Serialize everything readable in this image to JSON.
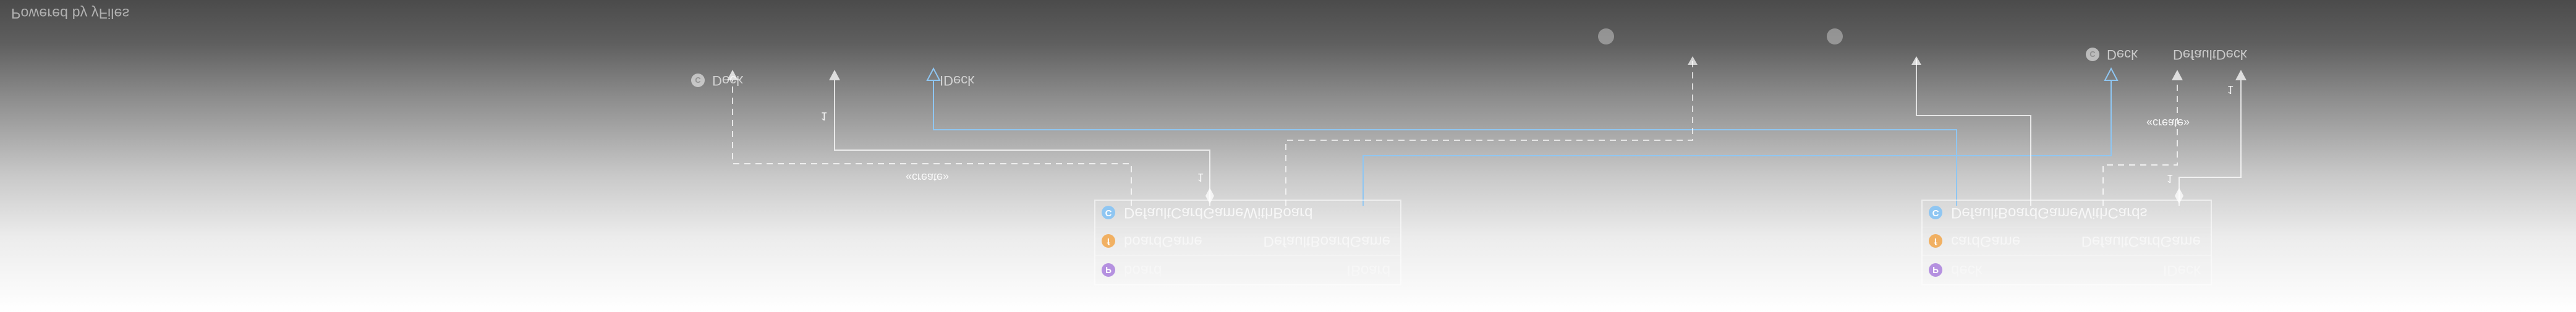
{
  "watermark": "Powered by yFiles",
  "classes": {
    "left": {
      "name": "DefaultCardGameWithBoard",
      "kind_badge": "C",
      "fields": [
        {
          "badge": "f",
          "name": "boardGame",
          "type": "DefaultBoardGame"
        },
        {
          "badge": "p",
          "name": "board",
          "type": "IBoard"
        }
      ]
    },
    "right": {
      "name": "DefaultBoardGameWithCards",
      "kind_badge": "C",
      "fields": [
        {
          "badge": "f",
          "name": "cardGame",
          "type": "DefaultCardGame"
        },
        {
          "badge": "p",
          "name": "deck",
          "type": "IDeck"
        }
      ]
    }
  },
  "relations": {
    "create_left": "«create»",
    "create_right": "«create»",
    "multiplicity_left": "1",
    "multiplicity_right": "1",
    "multiplicity_left_bottom": "1",
    "multiplicity_right_bottom": "1"
  },
  "reflections": {
    "left_a": "Deck",
    "left_b": "IDeck",
    "right_a": "Deck",
    "right_b": "DefaultDeck"
  },
  "colors": {
    "edge_blue": "#8fc6f2",
    "edge_gray": "#f2f2f2",
    "class_badge": "#8fc6f2",
    "field_badge": "#f1b062",
    "property_badge": "#b591e0"
  }
}
